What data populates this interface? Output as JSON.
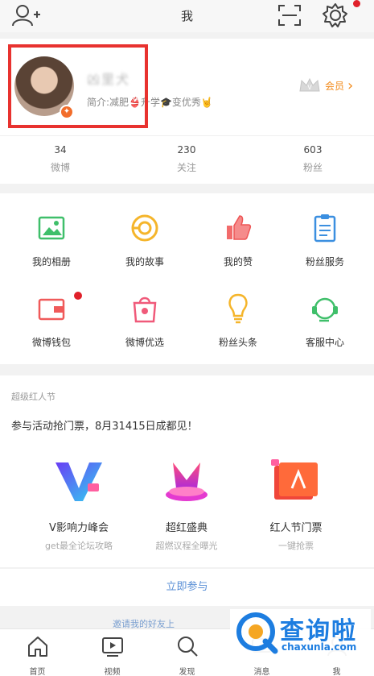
{
  "topbar": {
    "title": "我"
  },
  "profile": {
    "username": "凶里犬",
    "bio": "简介:减肥👙升学🎓变优秀🤘",
    "vip_label": "会员",
    "stats": [
      {
        "num": "34",
        "label": "微博"
      },
      {
        "num": "230",
        "label": "关注"
      },
      {
        "num": "603",
        "label": "粉丝"
      }
    ]
  },
  "grid": [
    {
      "label": "我的相册",
      "icon": "photo-icon"
    },
    {
      "label": "我的故事",
      "icon": "story-icon"
    },
    {
      "label": "我的赞",
      "icon": "thumbs-up-icon"
    },
    {
      "label": "粉丝服务",
      "icon": "clipboard-icon"
    },
    {
      "label": "微博钱包",
      "icon": "wallet-icon"
    },
    {
      "label": "微博优选",
      "icon": "shopping-bag-icon"
    },
    {
      "label": "粉丝头条",
      "icon": "lightbulb-icon"
    },
    {
      "label": "客服中心",
      "icon": "headset-icon"
    }
  ],
  "promo": {
    "tag": "超级红人节",
    "headline": "参与活动抢门票，8月31415日成都见！",
    "cards": [
      {
        "name": "V影响力峰会",
        "sub": "get最全论坛攻略"
      },
      {
        "name": "超红盛典",
        "sub": "超燃议程全曝光"
      },
      {
        "name": "红人节门票",
        "sub": "一键抢票"
      }
    ],
    "join": "立即参与",
    "peek": "邀请我的好友上"
  },
  "tabs": [
    {
      "label": "首页"
    },
    {
      "label": "视频"
    },
    {
      "label": "发现"
    },
    {
      "label": "消息"
    },
    {
      "label": "我"
    }
  ],
  "watermark": {
    "big": "查询啦",
    "small": "chaxunla.com"
  },
  "colors": {
    "accent": "#f28a1a",
    "highlight": "#e8322f",
    "link": "#5a8fd6"
  }
}
